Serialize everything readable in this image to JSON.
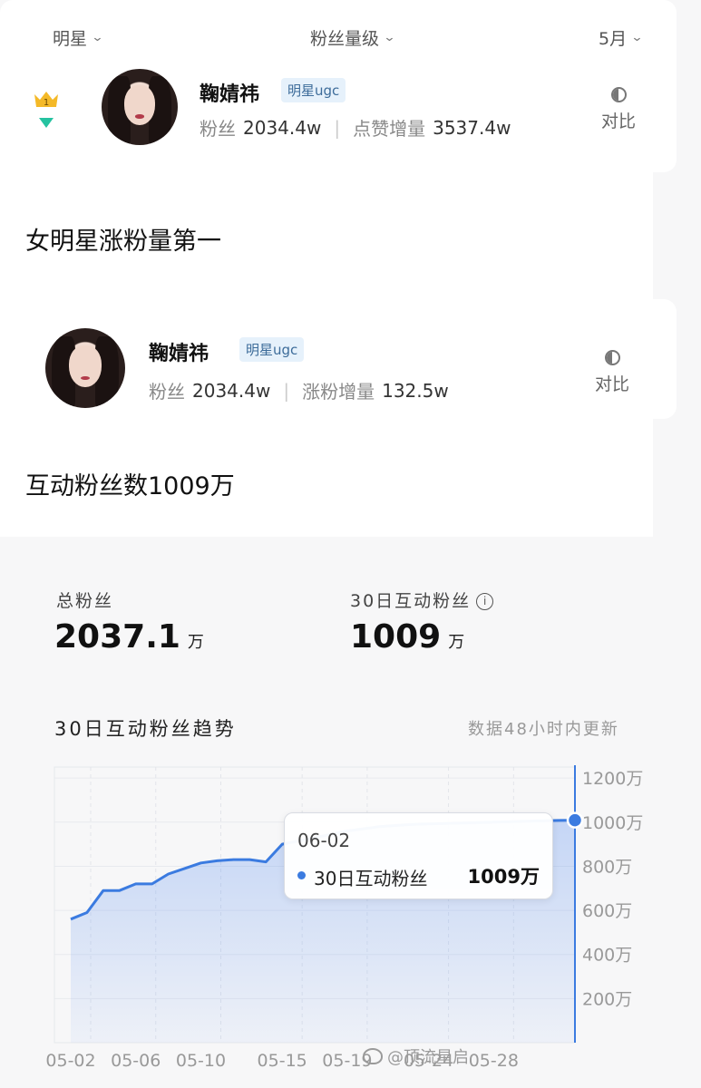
{
  "filters": {
    "category": "明星",
    "fans_level": "粉丝量级",
    "month": "5月"
  },
  "top_entry": {
    "rank": "1",
    "name": "鞠婧祎",
    "tag": "明星ugc",
    "fans_label": "粉丝",
    "fans_value": "2034.4w",
    "metric_label": "点赞增量",
    "metric_value": "3537.4w",
    "compare_label": "对比"
  },
  "caption1": "女明星涨粉量第一",
  "second_entry": {
    "name": "鞠婧祎",
    "tag": "明星ugc",
    "fans_label": "粉丝",
    "fans_value": "2034.4w",
    "metric_label": "涨粉增量",
    "metric_value": "132.5w",
    "compare_label": "对比"
  },
  "caption2": "互动粉丝数1009万",
  "metrics": {
    "total_fans_label": "总粉丝",
    "total_fans_value": "2037.1",
    "total_fans_unit": "万",
    "interactive_label": "30日互动粉丝",
    "interactive_value": "1009",
    "interactive_unit": "万"
  },
  "trend": {
    "title": "30日互动粉丝趋势",
    "note": "数据48小时内更新"
  },
  "tooltip": {
    "date": "06-02",
    "series": "30日互动粉丝",
    "value": "1009万"
  },
  "watermark": "@顶流星启",
  "colors": {
    "accent": "#3b7be0",
    "tag_bg": "#e6f1fb",
    "tag_text": "#3d6c9a",
    "rank_arrow": "#25c2a0",
    "crown": "#f4b928"
  },
  "chart_data": {
    "type": "area",
    "x": [
      "05-02",
      "05-03",
      "05-04",
      "05-05",
      "05-06",
      "05-07",
      "05-08",
      "05-09",
      "05-10",
      "05-11",
      "05-12",
      "05-13",
      "05-14",
      "05-15",
      "05-16",
      "05-17",
      "05-18",
      "05-19",
      "05-20",
      "05-21",
      "05-22",
      "05-23",
      "05-24",
      "05-25",
      "05-26",
      "05-27",
      "05-28",
      "05-29",
      "05-30",
      "05-31",
      "06-01",
      "06-02"
    ],
    "series": [
      {
        "name": "30日互动粉丝",
        "values": [
          560,
          590,
          690,
          690,
          720,
          720,
          765,
          790,
          815,
          825,
          830,
          830,
          820,
          900,
          915,
          930,
          945,
          960,
          970,
          980,
          985,
          990,
          992,
          994,
          996,
          998,
          1000,
          1002,
          1004,
          1006,
          1008,
          1009
        ]
      }
    ],
    "x_ticks": [
      "05-02",
      "05-06",
      "05-10",
      "05-15",
      "05-19",
      "05-24",
      "05-28"
    ],
    "y_ticks": [
      "200万",
      "400万",
      "600万",
      "800万",
      "1000万",
      "1200万"
    ],
    "ylim": [
      0,
      1250
    ],
    "grid": true
  }
}
